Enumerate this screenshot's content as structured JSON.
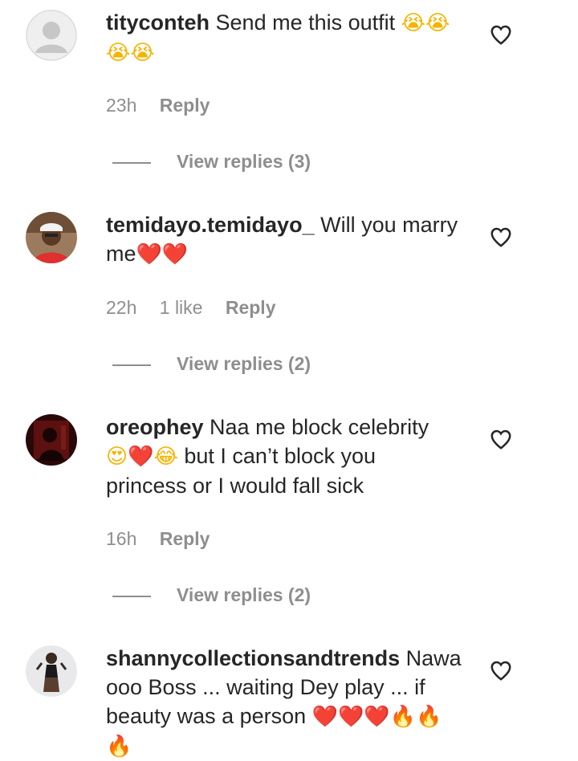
{
  "comments": [
    {
      "username": "tityconteh",
      "text": "Send me this outfit",
      "emojis": "😭😭",
      "emojis2": "😭😭",
      "time": "23h",
      "likes": "",
      "reply_label": "Reply",
      "view_replies": "View replies (3)",
      "avatar": "default-avatar"
    },
    {
      "username": "temidayo.temidayo_",
      "text": "Will you marry",
      "text2": "me",
      "emojis": "❤️❤️",
      "time": "22h",
      "likes": "1 like",
      "reply_label": "Reply",
      "view_replies": "View replies (2)",
      "avatar": "user-photo"
    },
    {
      "username": "oreophey",
      "text": "Naa me block celebrity",
      "emojis": "😍❤️😂",
      "text2": "but I can’t block you",
      "text3": "princess or I would fall sick",
      "time": "16h",
      "likes": "",
      "reply_label": "Reply",
      "view_replies": "View replies (2)",
      "avatar": "user-photo"
    },
    {
      "username": "shannycollectionsandtrends",
      "text": "Nawa",
      "text2": "ooo Boss ... waiting Dey play ... if",
      "text3": "beauty was a person",
      "emojis": "❤️❤️❤️🔥🔥",
      "emojis2": "🔥",
      "avatar": "user-photo"
    }
  ],
  "colors": {
    "text": "#262626",
    "secondary": "#8e8e8e",
    "heart_red": "#e0245e"
  }
}
